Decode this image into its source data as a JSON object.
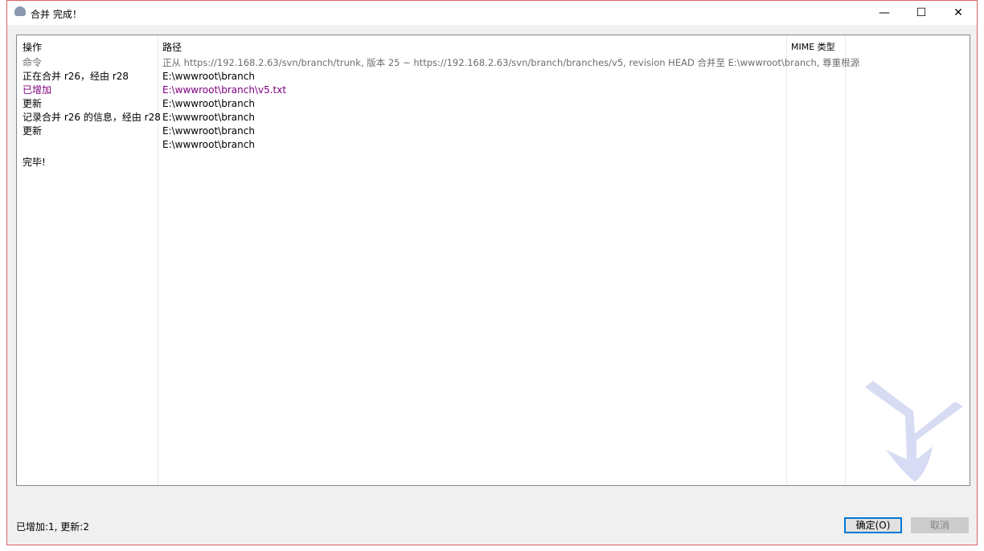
{
  "window": {
    "title": "合并 完成！",
    "minimize": "—",
    "maximize": "☐",
    "close": "✕"
  },
  "list": {
    "headers": {
      "action": "操作",
      "path": "路径",
      "mime": "MIME 类型"
    },
    "rows": [
      {
        "action": "命令",
        "path": "正从 https://192.168.2.63/svn/branch/trunk, 版本 25 ~ https://192.168.2.63/svn/branch/branches/v5, revision HEAD 合并至 E:\\wwwroot\\branch, 尊重根源",
        "style": "gray"
      },
      {
        "action": "正在合并 r26，经由 r28",
        "path": "E:\\wwwroot\\branch",
        "style": ""
      },
      {
        "action": "已增加",
        "path": "E:\\wwwroot\\branch\\v5.txt",
        "style": "purple"
      },
      {
        "action": "更新",
        "path": "E:\\wwwroot\\branch",
        "style": ""
      },
      {
        "action": "记录合并 r26 的信息，经由 r28",
        "path": "E:\\wwwroot\\branch",
        "style": ""
      },
      {
        "action": "更新",
        "path": "E:\\wwwroot\\branch",
        "style": ""
      },
      {
        "action": "",
        "path": "E:\\wwwroot\\branch",
        "style": ""
      },
      {
        "action": "完毕!",
        "path": "",
        "style": ""
      }
    ]
  },
  "status": "已增加:1, 更新:2",
  "buttons": {
    "ok": "确定(O)",
    "cancel": "取消"
  }
}
